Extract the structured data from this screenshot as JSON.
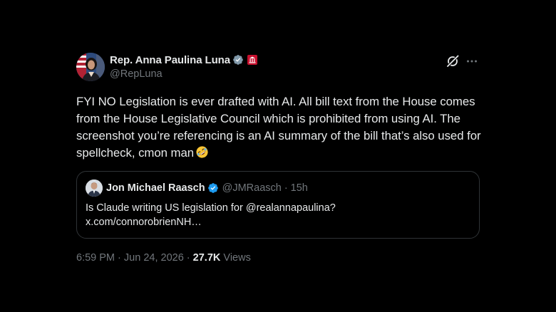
{
  "author": {
    "display_name": "Rep. Anna Paulina Luna",
    "handle": "@RepLuna",
    "verified_badge_color": "#829aab",
    "affiliation_badge_color": "#c8102e"
  },
  "icons": {
    "avatar": "avatar",
    "verified": "verified-badge-icon",
    "affiliation": "us-house-affiliation-icon",
    "grok": "grok-icon",
    "more": "more-icon",
    "emoji": "rolling-on-floor-laughing-emoji"
  },
  "tweet": {
    "text": "FYI NO Legislation is ever drafted with AI. All bill text from the House comes from the House Legislative Council which is prohibited from using AI. The screenshot you’re referencing is an AI summary of the bill that’s also used for spellcheck, cmon man",
    "time": "6:59 PM",
    "date": "Jun 24, 2026",
    "sep": "·",
    "views_count": "27.7K",
    "views_label": "Views"
  },
  "quote": {
    "display_name": "Jon Michael Raasch",
    "handle": "@JMRaasch",
    "dot": "·",
    "time": "15h",
    "verified_badge_color": "#1d9bf0",
    "line1": "Is Claude writing US legislation for @realannapaulina?",
    "line2": "x.com/connorobrienNH…"
  }
}
